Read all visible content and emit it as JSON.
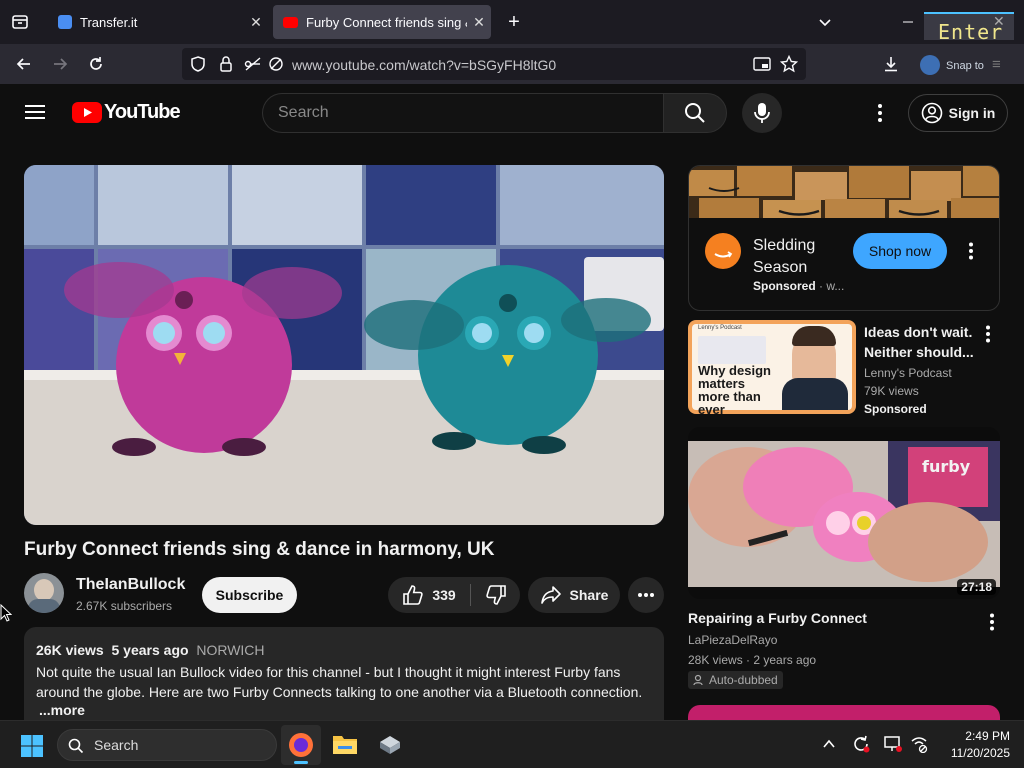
{
  "browser": {
    "tabs": [
      {
        "title": "Transfer.it",
        "active": false
      },
      {
        "title": "Furby Connect friends sing & da",
        "active": true
      }
    ],
    "url": "www.youtube.com/watch?v=bSGyFH8ltG0",
    "overlay_enter": "Enter",
    "overlay_snap": "Snap to"
  },
  "youtube": {
    "logo_text": "YouTube",
    "search_placeholder": "Search",
    "sign_in": "Sign in",
    "video": {
      "title": "Furby Connect friends sing & dance in harmony, UK",
      "channel": "TheIanBullock",
      "subscribers": "2.67K subscribers",
      "subscribe": "Subscribe",
      "likes": "339",
      "share": "Share",
      "views": "26K views",
      "age": "5 years ago",
      "location": "NORWICH",
      "description": "Not quite the usual Ian Bullock video for this channel - but I thought it might interest Furby fans around the globe. Here are two Furby Connects talking to one another via a Bluetooth connection.",
      "more": "...more"
    },
    "ad": {
      "title_line1": "Sledding",
      "title_line2": "Season",
      "sponsored": "Sponsored",
      "sponsor_suffix": "· w...",
      "cta": "Shop now"
    },
    "recommendations": [
      {
        "title_line1": "Ideas don't wait.",
        "title_line2": "Neither should...",
        "channel": "Lenny's Podcast",
        "views": "79K views",
        "badge": "Sponsored",
        "thumb_text": "Why design matters more than ever",
        "thumb_header": "Lenny's Podcast"
      },
      {
        "title": "Repairing a Furby Connect",
        "channel": "LaPiezaDelRayo",
        "views_age": "28K views · 2 years ago",
        "badge": "Auto-dubbed",
        "duration": "27:18",
        "thumb_text": "furby"
      }
    ]
  },
  "taskbar": {
    "search": "Search",
    "time": "2:49 PM",
    "date": "11/20/2025"
  },
  "colors": {
    "yt_red": "#ff0000",
    "accent_blue": "#3ea6ff",
    "shop_blue": "#3ea6ff",
    "amazon_orange": "#f58020",
    "taskbar_blue": "#4cc2ff"
  }
}
